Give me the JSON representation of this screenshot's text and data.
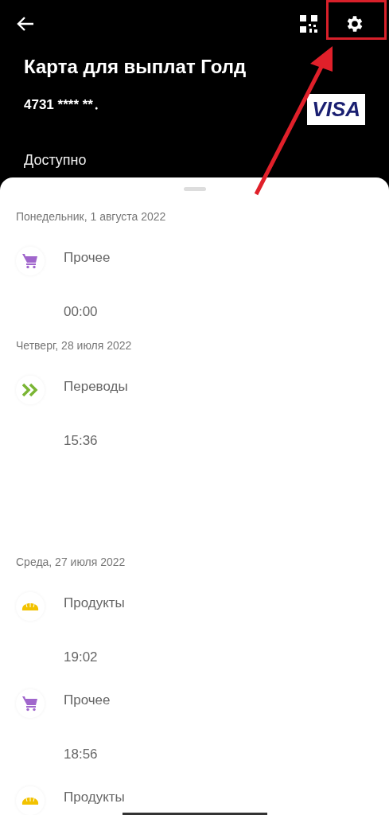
{
  "header": {
    "title": "Карта для выплат Голд",
    "card_number": "4731 **** **․",
    "balance_label": "Доступно",
    "brand": "VISA"
  },
  "days": [
    {
      "date": "Понедельник, 1 августа 2022",
      "transactions": [
        {
          "kind": "cart",
          "category": "Прочее",
          "time": "00:00"
        }
      ]
    },
    {
      "date": "Четверг, 28 июля 2022",
      "transactions": [
        {
          "kind": "transfer",
          "category": "Переводы",
          "time": "15:36"
        }
      ]
    },
    {
      "date": "Среда, 27 июля 2022",
      "transactions": [
        {
          "kind": "bread",
          "category": "Продукты",
          "time": "19:02"
        },
        {
          "kind": "cart",
          "category": "Прочее",
          "time": "18:56"
        },
        {
          "kind": "bread",
          "category": "Продукты"
        }
      ]
    }
  ]
}
